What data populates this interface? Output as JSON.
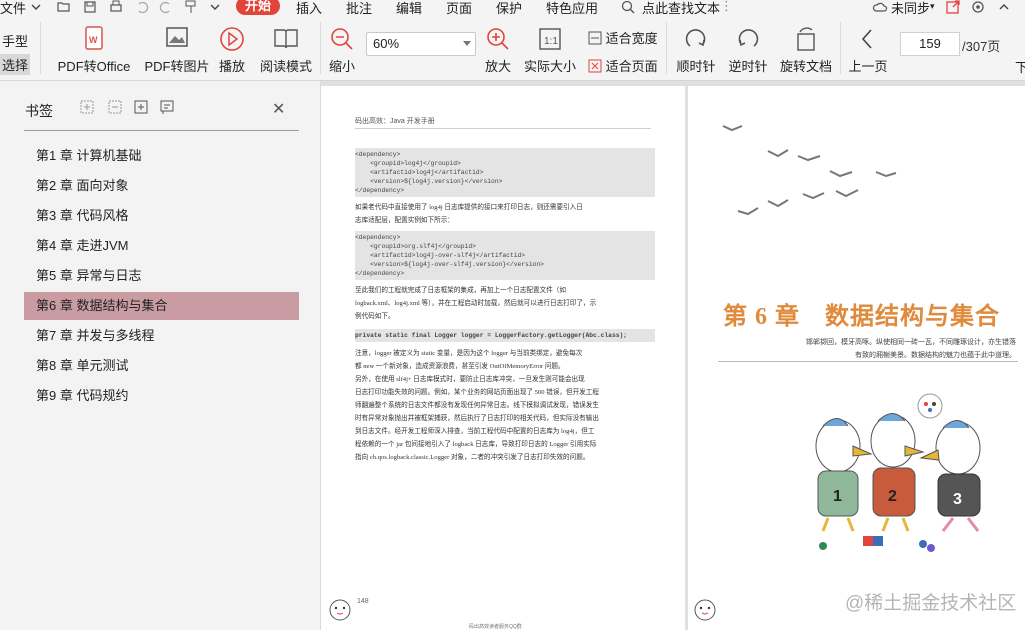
{
  "menu": {
    "file": "文件",
    "items": [
      "开始",
      "插入",
      "批注",
      "编辑",
      "页面",
      "保护",
      "特色应用"
    ],
    "search": "点此查找文本",
    "sync": "未同步"
  },
  "toolbar": {
    "hand": "手型",
    "select": "选择",
    "pdf_to_office": "PDF转Office",
    "pdf_to_image": "PDF转图片",
    "play": "播放",
    "read_mode": "阅读模式",
    "zoom_out": "缩小",
    "zoom_value": "60%",
    "zoom_in": "放大",
    "actual_size": "实际大小",
    "fit_width": "适合宽度",
    "fit_page": "适合页面",
    "rotate_cw": "顺时针",
    "rotate_ccw": "逆时针",
    "rotate_doc": "旋转文档",
    "prev_page": "上一页",
    "next_page": "下",
    "page_current": "159",
    "page_total": "/307页"
  },
  "sidebar": {
    "title": "书签",
    "items": [
      {
        "label": "第1 章 计算机基础"
      },
      {
        "label": "第2 章 面向对象"
      },
      {
        "label": "第3 章 代码风格"
      },
      {
        "label": "第4 章 走进JVM"
      },
      {
        "label": "第5 章 异常与日志"
      },
      {
        "label": "第6 章 数据结构与集合"
      },
      {
        "label": "第7 章 并发与多线程"
      },
      {
        "label": "第8 章 单元测试"
      },
      {
        "label": "第9 章 代码规约"
      }
    ],
    "selected_index": 5
  },
  "left_page": {
    "header": "码出高效：Java 开发手册",
    "code1": [
      "<dependency>",
      "    <groupid>log4j</groupid>",
      "    <artifactid>log4j</artifactid>",
      "    <version>${log4j.version}</version>",
      "</dependency>"
    ],
    "para1": [
      "    如果老代码中直接使用了 log4j 日志库提供的接口来打印日志，则还需要引入日",
      "志库适配层，配置实例如下所示："
    ],
    "code2": [
      "<dependency>",
      "    <groupid>org.slf4j</groupid>",
      "    <artifactid>log4j-over-slf4j</artifactid>",
      "    <version>${log4j-over-slf4j.version}</version>",
      "</dependency>"
    ],
    "para2": [
      "    至此我们的工程就完成了日志框架的集成，再加上一个日志配置文件（如",
      "logback.xml、log4j.xml 等），并在工程启动时加载，然后就可以进行日志打印了，示",
      "例代码如下。"
    ],
    "code3": "private static final Logger logger = LoggerFactory.getLogger(Abc.class);",
    "para3": [
      "    注意，logger 被定义为 static 变量，是因为这个 logger 与当前类绑定，避免每次",
      "都 new 一个新对象，造成资源浪费，甚至引发 OutOfMemoryError 问题。",
      "    另外，在使用 slf4j+ 日志库模式时，要防止日志库冲突，一旦发生则可能会出现",
      "日志打印功能失效的问题。例如，某个业务的网站页面出现了 500 错误，但开发工程",
      "师翻遍整个系统的日志文件都没有发现任何异常日志。线下模拟调试发现，错误发生",
      "时有异常对象抛出并被框架捕获，然后执行了日志打印的相关代码，但实际没有输出",
      "到日志文件。经开发工程师深入排查，当前工程代码中配置的日志库为 log4j，但工",
      "程依赖的一个 jar 包间接地引入了 logback 日志库，导致打印日志的 Logger 引用实际",
      "指向 ch.qos.logback.classic.Logger 对象，二者的冲突引发了日志打印失效的问题。"
    ],
    "page_number": "148",
    "footer": "码出高效读者服务QQ群"
  },
  "right_page": {
    "chapter_title": "第 6 章　数据结构与集合",
    "chapter_sub": [
      "邯郸撷回，模牙高啄。纵使相同一砖一瓦，不同雕琢设计，亦生错落",
      "有致的厢榭美景。数据结构的魅力也蕴于此中道理。"
    ]
  },
  "watermark": "@稀土掘金技术社区",
  "colors": {
    "accent": "#e2443c",
    "selected_bookmark": "#c99ba2",
    "chapter_orange": "#e08a3c"
  }
}
